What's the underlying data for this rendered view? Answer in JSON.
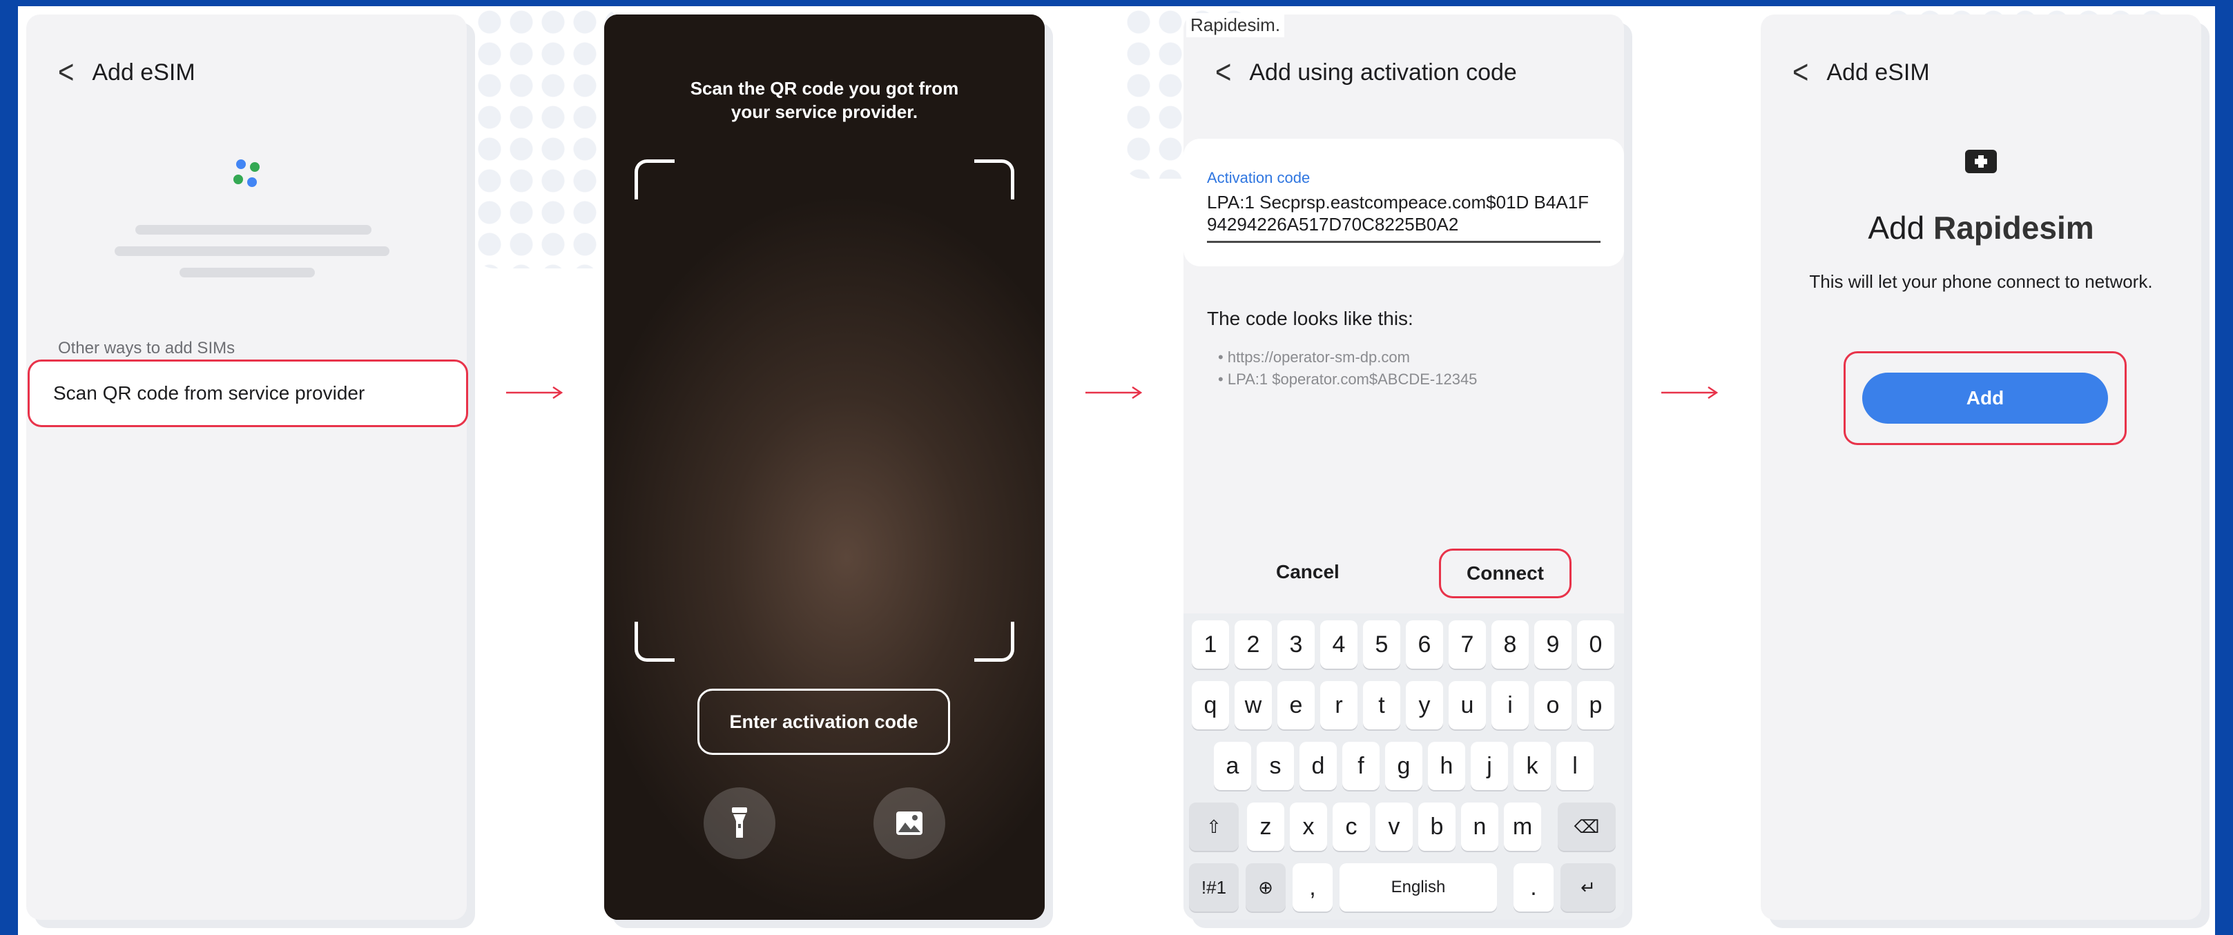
{
  "colors": {
    "frame": "#0a46a8",
    "accent": "#e8334a",
    "primary": "#3a80ea",
    "link": "#2f76e0"
  },
  "step1": {
    "header": "Add eSIM",
    "subheading": "Other ways to add SIMs",
    "option": "Scan QR code from service provider"
  },
  "step2": {
    "instruction_line1": "Scan the QR code you got from",
    "instruction_line2": "your service provider.",
    "enter_code": "Enter activation code",
    "flashlight_icon": "flashlight-icon",
    "gallery_icon": "image-icon"
  },
  "step3": {
    "banner": "Rapidesim.",
    "header": "Add using activation code",
    "field_label": "Activation code",
    "field_value": "LPA:1 Secprsp.eastcompeace.com$01D B4A1F94294226A517D70C8225B0A2",
    "looks_like": "The code looks like this:",
    "examples": [
      "https://operator-sm-dp.com",
      "LPA:1 $operator.com$ABCDE-12345"
    ],
    "cancel": "Cancel",
    "connect": "Connect",
    "keyboard": {
      "row1": [
        "1",
        "2",
        "3",
        "4",
        "5",
        "6",
        "7",
        "8",
        "9",
        "0"
      ],
      "row2": [
        "q",
        "w",
        "e",
        "r",
        "t",
        "y",
        "u",
        "i",
        "o",
        "p"
      ],
      "row3": [
        "a",
        "s",
        "d",
        "f",
        "g",
        "h",
        "j",
        "k",
        "l"
      ],
      "row4": [
        "z",
        "x",
        "c",
        "v",
        "b",
        "n",
        "m"
      ],
      "shift": "⇧",
      "backspace": "⌫",
      "symbols": "!#1",
      "globe": "⊕",
      "comma": ",",
      "space": "English",
      "period": ".",
      "enter": "↵"
    }
  },
  "step4": {
    "header": "Add eSIM",
    "title_prefix": "Add",
    "title_brand": "Rapidesim",
    "description": "This will let your phone connect to network.",
    "add_button": "Add"
  }
}
